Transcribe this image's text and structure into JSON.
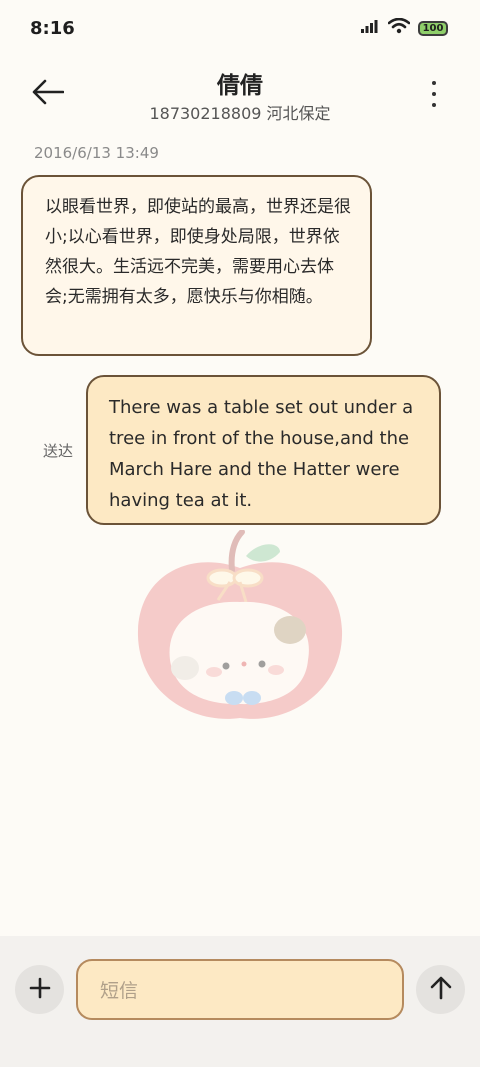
{
  "status_bar": {
    "time": "8:16",
    "battery_label": "100",
    "icons": [
      "network-signal-icon",
      "wifi-icon",
      "battery-icon"
    ],
    "battery_color": "#8fcf6a"
  },
  "header": {
    "contact_name": "倩倩",
    "contact_sub": "18730218809 河北保定",
    "icons": [
      "back-arrow-icon",
      "more-vertical-icon"
    ]
  },
  "conversation": {
    "timestamp": "2016/6/13 13:49",
    "messages": [
      {
        "direction": "incoming",
        "text": "以眼看世界，即使站的最高，世界还是很小;以心看世界，即使身处局限，世界依然很大。生活远不完美，需要用心去体会;无需拥有太多，愿快乐与你相随。",
        "bg": "#fff7ea"
      },
      {
        "direction": "outgoing",
        "text": "There was a table set out under a tree in front of the house,and the March Hare and the Hatter were having tea at it.",
        "status": "送达",
        "bg": "#fde9c4"
      }
    ]
  },
  "composer": {
    "placeholder": "短信",
    "icons": [
      "plus-icon",
      "send-arrow-icon"
    ],
    "accent": "#fde9c4"
  }
}
